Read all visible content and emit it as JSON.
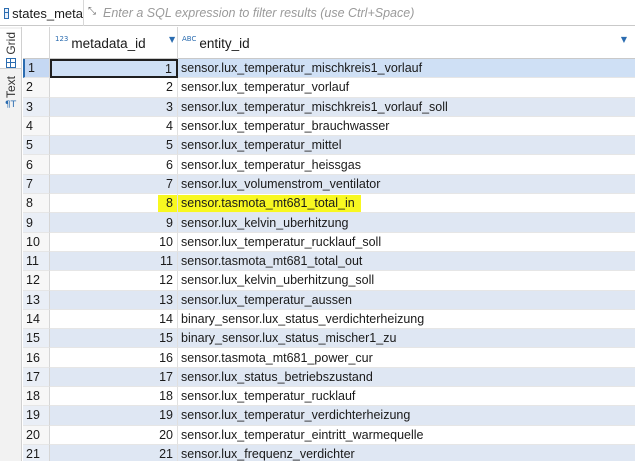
{
  "tab": {
    "icon": "table-icon",
    "label": "states_meta"
  },
  "filter": {
    "expand_icon": "expand-arrows-icon",
    "glyph": "⤡",
    "placeholder": "Enter a SQL expression to filter results (use Ctrl+Space)"
  },
  "side_tabs": [
    {
      "label": "Grid",
      "icon": "grid-icon"
    },
    {
      "label": "Text",
      "icon": "text-icon",
      "glyph": "¶T"
    }
  ],
  "columns": [
    {
      "label": "metadata_id",
      "type_glyph": "123",
      "sort_glyph": "▼"
    },
    {
      "label": "entity_id",
      "type_glyph": "ABC",
      "sort_glyph": "▼"
    }
  ],
  "highlight_color": "#f8f820",
  "rows": [
    {
      "num": "1",
      "id": "1",
      "entity": "sensor.lux_temperatur_mischkreis1_vorlauf",
      "selected": true
    },
    {
      "num": "2",
      "id": "2",
      "entity": "sensor.lux_temperatur_vorlauf"
    },
    {
      "num": "3",
      "id": "3",
      "entity": "sensor.lux_temperatur_mischkreis1_vorlauf_soll"
    },
    {
      "num": "4",
      "id": "4",
      "entity": "sensor.lux_temperatur_brauchwasser"
    },
    {
      "num": "5",
      "id": "5",
      "entity": "sensor.lux_temperatur_mittel"
    },
    {
      "num": "6",
      "id": "6",
      "entity": "sensor.lux_temperatur_heissgas"
    },
    {
      "num": "7",
      "id": "7",
      "entity": "sensor.lux_volumenstrom_ventilator"
    },
    {
      "num": "8",
      "id": "8",
      "entity": "sensor.tasmota_mt681_total_in",
      "highlighted": true
    },
    {
      "num": "9",
      "id": "9",
      "entity": "sensor.lux_kelvin_uberhitzung"
    },
    {
      "num": "10",
      "id": "10",
      "entity": "sensor.lux_temperatur_rucklauf_soll"
    },
    {
      "num": "11",
      "id": "11",
      "entity": "sensor.tasmota_mt681_total_out"
    },
    {
      "num": "12",
      "id": "12",
      "entity": "sensor.lux_kelvin_uberhitzung_soll"
    },
    {
      "num": "13",
      "id": "13",
      "entity": "sensor.lux_temperatur_aussen"
    },
    {
      "num": "14",
      "id": "14",
      "entity": "binary_sensor.lux_status_verdichterheizung"
    },
    {
      "num": "15",
      "id": "15",
      "entity": "binary_sensor.lux_status_mischer1_zu"
    },
    {
      "num": "16",
      "id": "16",
      "entity": "sensor.tasmota_mt681_power_cur"
    },
    {
      "num": "17",
      "id": "17",
      "entity": "sensor.lux_status_betriebszustand",
      "highlighted": true
    },
    {
      "num": "18",
      "id": "18",
      "entity": "sensor.lux_temperatur_rucklauf"
    },
    {
      "num": "19",
      "id": "19",
      "entity": "sensor.lux_temperatur_verdichterheizung"
    },
    {
      "num": "20",
      "id": "20",
      "entity": "sensor.lux_temperatur_eintritt_warmequelle"
    },
    {
      "num": "21",
      "id": "21",
      "entity": "sensor.lux_frequenz_verdichter"
    }
  ]
}
